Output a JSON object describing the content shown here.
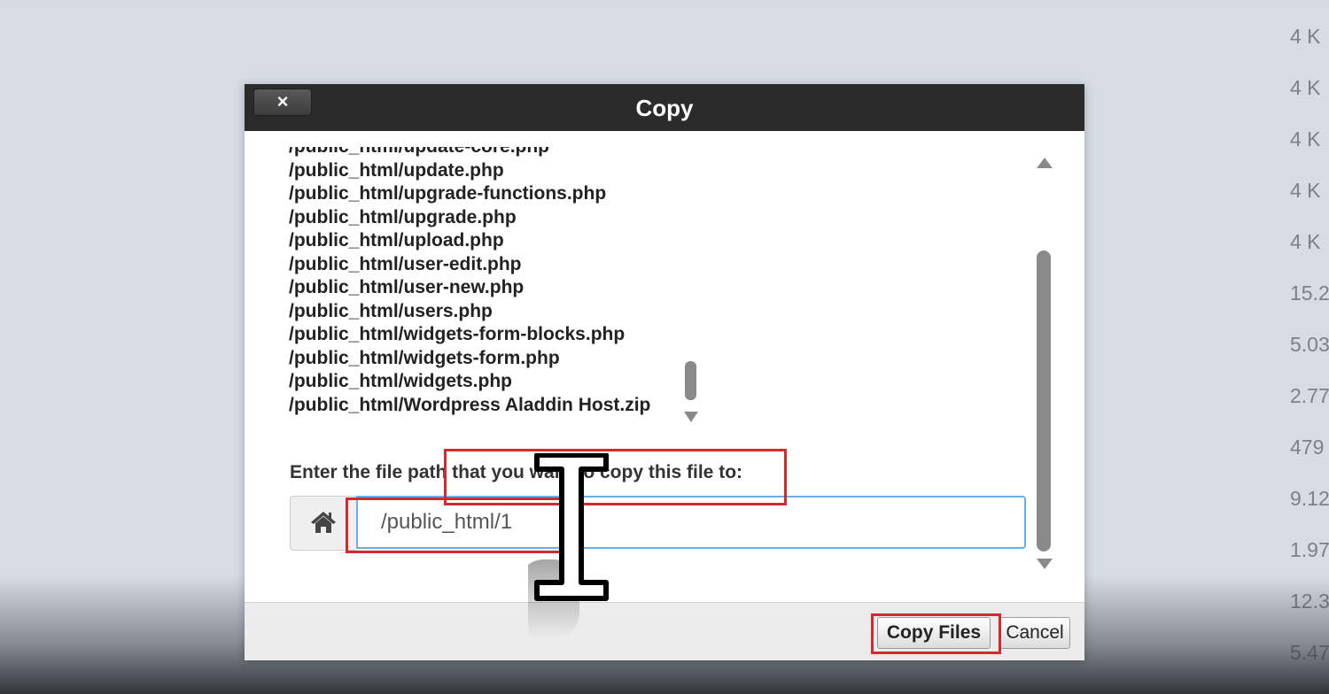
{
  "background": {
    "file_sizes": [
      "4 K",
      "4 K",
      "4 K",
      "4 K",
      "4 K",
      "15.2",
      "5.03",
      "2.77",
      "479",
      "9.12",
      "1.97",
      "12.3",
      "5.47"
    ]
  },
  "dialog": {
    "close_label": "×",
    "title": "Copy",
    "file_list": [
      "/public_html/update-core.php",
      "/public_html/update.php",
      "/public_html/upgrade-functions.php",
      "/public_html/upgrade.php",
      "/public_html/upload.php",
      "/public_html/user-edit.php",
      "/public_html/user-new.php",
      "/public_html/users.php",
      "/public_html/widgets-form-blocks.php",
      "/public_html/widgets-form.php",
      "/public_html/widgets.php",
      "/public_html/Wordpress Aladdin Host.zip"
    ],
    "prompt": "Enter the file path that you want to copy this file to:",
    "path_value": "/public_html/1",
    "home_icon": "home-icon",
    "copy_button": "Copy Files",
    "cancel_button": "Cancel"
  },
  "colors": {
    "header": "#2b2b2b",
    "annotation": "#d42a2a",
    "input_focus": "#66afe9"
  }
}
